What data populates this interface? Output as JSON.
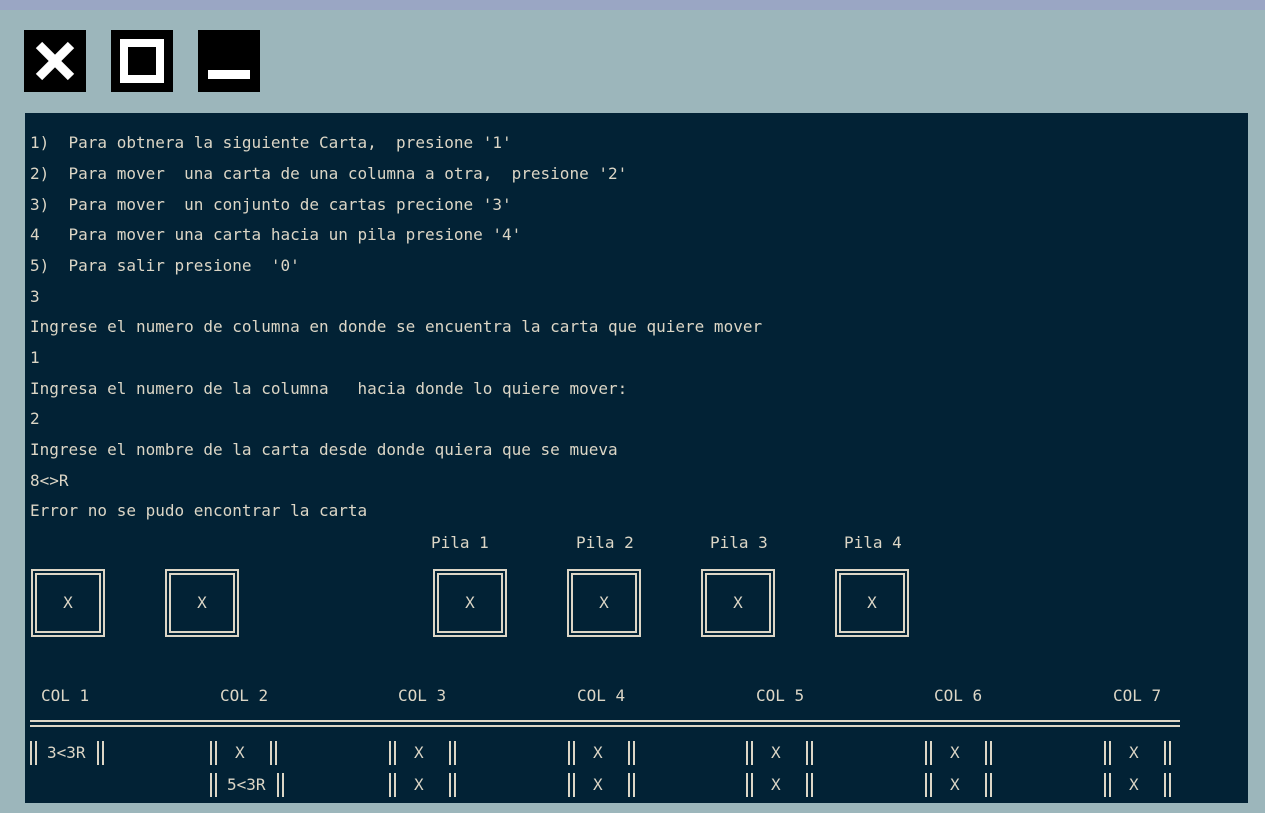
{
  "window_controls": {
    "close_icon": "close-icon",
    "maximize_icon": "maximize-icon",
    "minimize_icon": "minimize-icon"
  },
  "terminal": {
    "lines": [
      "1)  Para obtnera la siguiente Carta,  presione '1'",
      "2)  Para mover  una carta de una columna a otra,  presione '2'",
      "3)  Para mover  un conjunto de cartas precione '3'",
      "4   Para mover una carta hacia un pila presione '4'",
      "5)  Para salir presione  '0'",
      "3",
      "Ingrese el numero de columna en donde se encuentra la carta que quiere mover",
      "1",
      "Ingresa el numero de la columna   hacia donde lo quiere mover:",
      "2",
      "Ingrese el nombre de la carta desde donde quiera que se mueva",
      "8<>R",
      "Error no se pudo encontrar la carta"
    ],
    "piles_labels": [
      "Pila 1",
      "Pila 2",
      "Pila 3",
      "Pila 4"
    ],
    "deck_cards": [
      "X",
      "X"
    ],
    "pile_cards": [
      "X",
      "X",
      "X",
      "X"
    ],
    "columns": [
      "COL 1",
      "COL 2",
      "COL 3",
      "COL 4",
      "COL 5",
      "COL 6",
      "COL 7"
    ],
    "column_cells": [
      [
        "3<3R"
      ],
      [
        "X",
        "5<3R"
      ],
      [
        "X",
        "X"
      ],
      [
        "X",
        "X"
      ],
      [
        "X",
        "X"
      ],
      [
        "X",
        "X"
      ],
      [
        "X",
        "X"
      ]
    ]
  },
  "colors": {
    "terminal_bg": "#022235",
    "terminal_fg": "#dcd6c6",
    "frame_bg": "#9cb6bb"
  }
}
